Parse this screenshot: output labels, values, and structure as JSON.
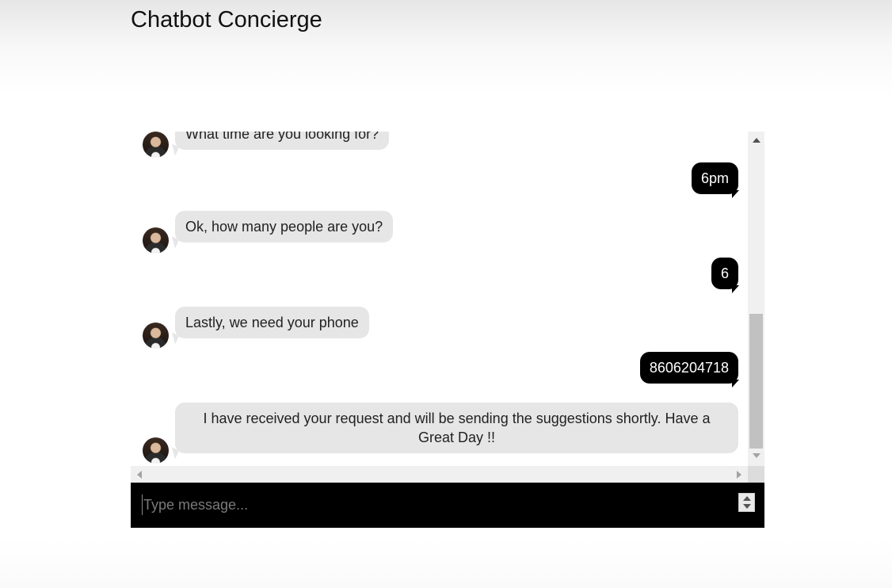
{
  "app": {
    "title": "Chatbot Concierge"
  },
  "chat": {
    "messages": [
      {
        "sender": "bot",
        "text": "What time are you looking for?"
      },
      {
        "sender": "user",
        "text": "6pm"
      },
      {
        "sender": "bot",
        "text": "Ok, how many people are you?"
      },
      {
        "sender": "user",
        "text": "6"
      },
      {
        "sender": "bot",
        "text": "Lastly, we need your phone"
      },
      {
        "sender": "user",
        "text": "8606204718"
      },
      {
        "sender": "bot",
        "text": "I have received your request and will be sending the suggestions shortly. Have a Great Day !!"
      }
    ]
  },
  "composer": {
    "placeholder": "Type message...",
    "value": ""
  },
  "colors": {
    "user_bubble": "#000000",
    "bot_bubble": "#e6e6e6",
    "input_bar": "#000000"
  },
  "icons": {
    "avatar": "bot-avatar",
    "spinner": "spinner-arrows-icon"
  }
}
